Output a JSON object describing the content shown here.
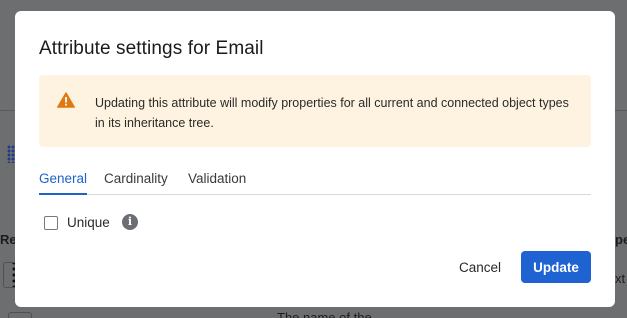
{
  "background": {
    "left_fragment_1": "Re",
    "left_fragment_2": "",
    "right_fragment_1": "pe",
    "right_fragment_2": "xt",
    "bottom_fragment": "The name of the"
  },
  "modal": {
    "title": "Attribute settings for Email",
    "alert": {
      "icon": "warning-triangle-icon",
      "color": "#e07a10",
      "background": "#fdf3e0",
      "text": "Updating this attribute will modify properties for all current and connected object types in its inheritance tree."
    },
    "tabs": [
      {
        "label": "General",
        "active": true
      },
      {
        "label": "Cardinality",
        "active": false
      },
      {
        "label": "Validation",
        "active": false
      }
    ],
    "unique": {
      "label": "Unique",
      "checked": false,
      "info_icon": "info-icon"
    },
    "buttons": {
      "cancel_label": "Cancel",
      "update_label": "Update"
    },
    "colors": {
      "accent": "#1f63d2",
      "overlay": "#6d6e70"
    }
  }
}
